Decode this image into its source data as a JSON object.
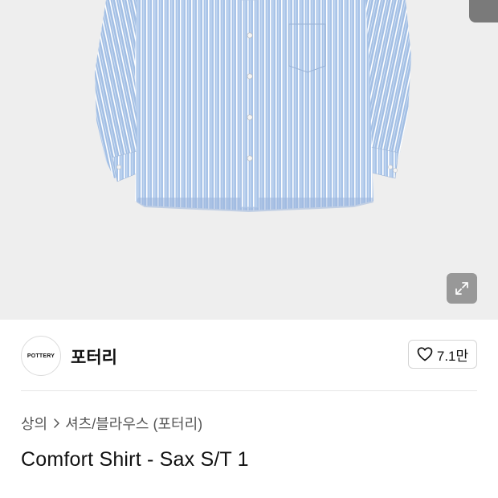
{
  "brand": {
    "logo_text": "POTTERY",
    "name": "포터리"
  },
  "like": {
    "icon": "heart-icon",
    "count": "7.1만"
  },
  "breadcrumb": {
    "category": "상의",
    "separator_icon": "chevron-right-icon",
    "subcategory": "셔츠/블라우스 (포터리)"
  },
  "product": {
    "title": "Comfort Shirt - Sax S/T 1",
    "image_colors": [
      "#a9c3e6",
      "#ffffff",
      "#eeeeee"
    ]
  },
  "hero": {
    "expand_icon": "expand-icon"
  }
}
